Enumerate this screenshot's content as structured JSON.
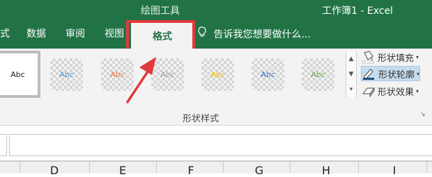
{
  "title_bar": {
    "context_tab_label": "绘图工具",
    "window_title": "工作簿1 - Excel"
  },
  "tabs": [
    {
      "label": "式"
    },
    {
      "label": "数据"
    },
    {
      "label": "审阅"
    },
    {
      "label": "视图"
    },
    {
      "label": "格式",
      "active": true
    }
  ],
  "tell_me": {
    "icon": "lightbulb-icon",
    "text": "告诉我您想要做什么..."
  },
  "shape_styles": {
    "swatches": [
      {
        "label": "Abc",
        "color": "#222222"
      },
      {
        "label": "Abc",
        "color": "#5b9bd5"
      },
      {
        "label": "Abc",
        "color": "#ed7d31"
      },
      {
        "label": "Abc",
        "color": "#a5a5a5"
      },
      {
        "label": "Abc",
        "color": "#ffc000"
      },
      {
        "label": "Abc",
        "color": "#4472c4"
      },
      {
        "label": "Abc",
        "color": "#70ad47"
      }
    ],
    "group_label": "形状样式"
  },
  "commands": [
    {
      "label": "形状填充",
      "icon": "paint-bucket-icon"
    },
    {
      "label": "形状轮廓",
      "icon": "pen-outline-icon"
    },
    {
      "label": "形状效果",
      "icon": "shape-effects-icon"
    }
  ],
  "columns": [
    "D",
    "E",
    "F",
    "G",
    "H",
    "I"
  ],
  "colors": {
    "accent": "#217346",
    "highlight": "#e23a3a"
  }
}
